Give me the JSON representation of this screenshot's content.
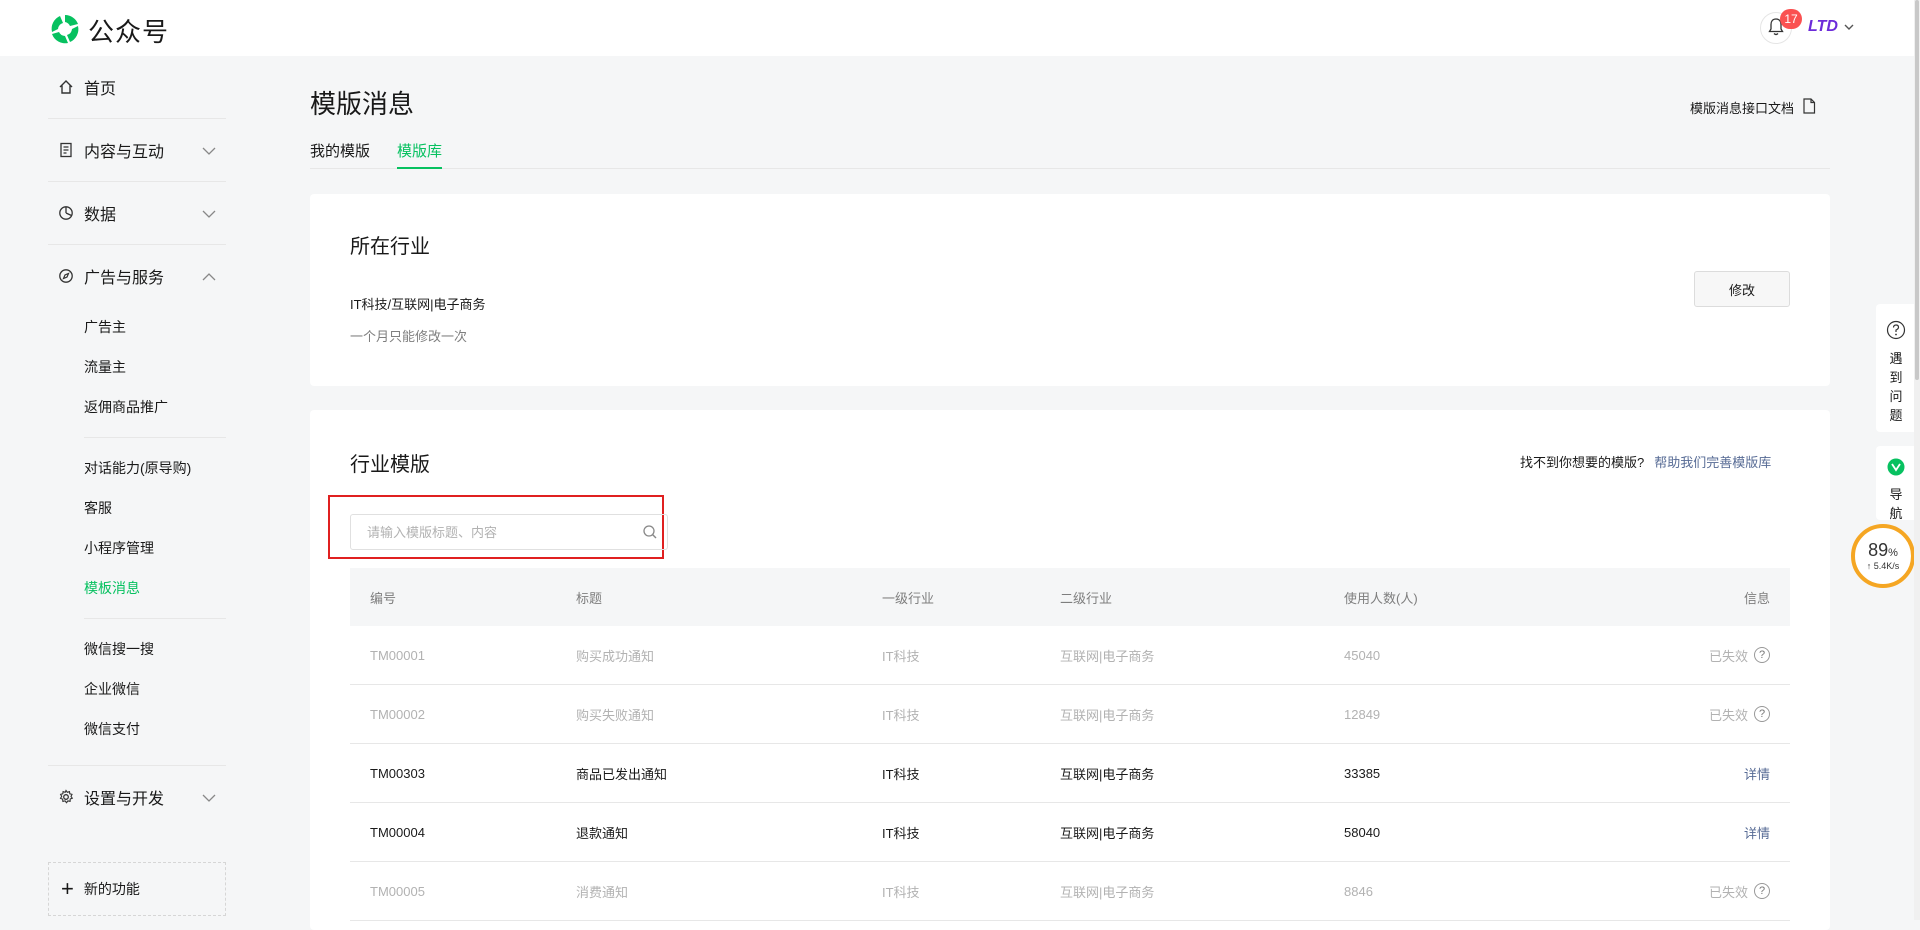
{
  "app": {
    "title": "公众号"
  },
  "header": {
    "notification_count": "17",
    "account_name": "LTD"
  },
  "sidebar": {
    "home": "首页",
    "content": "内容与互动",
    "data": "数据",
    "ads": "广告与服务",
    "ads_items": [
      "广告主",
      "流量主",
      "返佣商品推广"
    ],
    "service_items": [
      "对话能力(原导购)",
      "客服",
      "小程序管理",
      "模板消息"
    ],
    "other_items": [
      "微信搜一搜",
      "企业微信",
      "微信支付"
    ],
    "settings": "设置与开发",
    "new_features": "新的功能"
  },
  "page": {
    "title": "模版消息",
    "doc_link": "模版消息接口文档",
    "tabs": [
      "我的模版",
      "模版库"
    ]
  },
  "industry_card": {
    "title": "所在行业",
    "industry": "IT科技/互联网|电子商务",
    "note": "一个月只能修改一次",
    "modify_button": "修改"
  },
  "template_card": {
    "title": "行业模版",
    "help_text": "找不到你想要的模版?",
    "help_link": "帮助我们完善模版库",
    "search_placeholder": "请输入模版标题、内容",
    "columns": [
      "编号",
      "标题",
      "一级行业",
      "二级行业",
      "使用人数(人)",
      "信息"
    ],
    "rows": [
      {
        "id": "TM00001",
        "title": "购买成功通知",
        "industry1": "IT科技",
        "industry2": "互联网|电子商务",
        "users": "45040",
        "info": "已失效"
      },
      {
        "id": "TM00002",
        "title": "购买失败通知",
        "industry1": "IT科技",
        "industry2": "互联网|电子商务",
        "users": "12849",
        "info": "已失效"
      },
      {
        "id": "TM00303",
        "title": "商品已发出通知",
        "industry1": "IT科技",
        "industry2": "互联网|电子商务",
        "users": "33385",
        "info": "详情"
      },
      {
        "id": "TM00004",
        "title": "退款通知",
        "industry1": "IT科技",
        "industry2": "互联网|电子商务",
        "users": "58040",
        "info": "详情"
      },
      {
        "id": "TM00005",
        "title": "消费通知",
        "industry1": "IT科技",
        "industry2": "互联网|电子商务",
        "users": "8846",
        "info": "已失效"
      }
    ],
    "question_mark": "?"
  },
  "floating": {
    "help_text": "遇到问题",
    "nav_text": "导航",
    "gauge_percent": "89",
    "gauge_unit": "%",
    "gauge_speed": "↑ 5.4K/s"
  },
  "colors": {
    "accent": "#07c160",
    "link": "#576b95",
    "alert": "#fa5151",
    "highlight": "#e02020"
  }
}
